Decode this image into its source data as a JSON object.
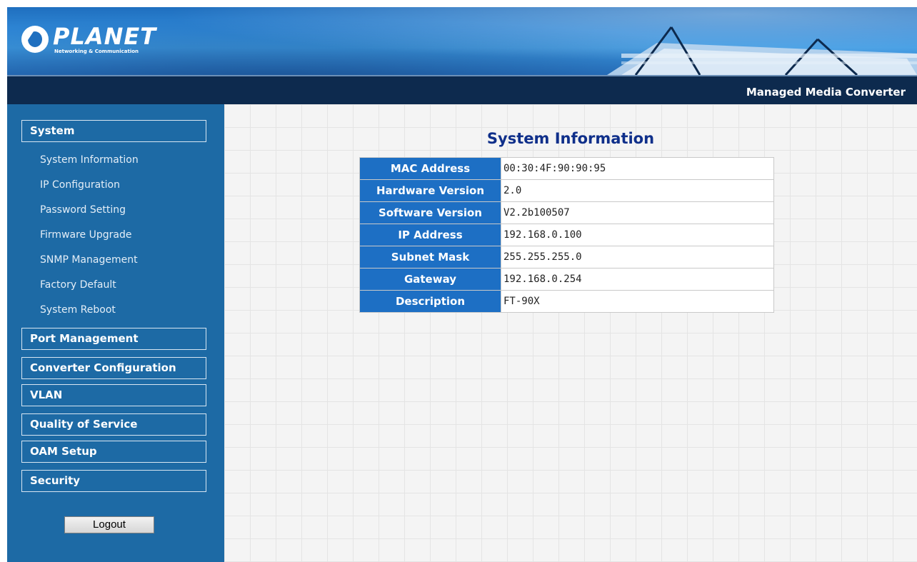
{
  "header": {
    "brand": "PLANET",
    "brand_tagline": "Networking & Communication",
    "product_name": "Managed Media Converter"
  },
  "sidebar": {
    "categories": [
      {
        "label": "System",
        "items": [
          "System Information",
          "IP Configuration",
          "Password Setting",
          "Firmware Upgrade",
          "SNMP Management",
          "Factory Default",
          "System Reboot"
        ]
      },
      {
        "label": "Port Management"
      },
      {
        "label": "Converter Configuration"
      },
      {
        "label": "VLAN"
      },
      {
        "label": "Quality of Service"
      },
      {
        "label": "OAM Setup"
      },
      {
        "label": "Security"
      }
    ],
    "logout_label": "Logout"
  },
  "main": {
    "title": "System Information",
    "rows": [
      {
        "key": "MAC Address",
        "value": "00:30:4F:90:90:95"
      },
      {
        "key": "Hardware Version",
        "value": "2.0"
      },
      {
        "key": "Software Version",
        "value": "V2.2b100507"
      },
      {
        "key": "IP Address",
        "value": "192.168.0.100"
      },
      {
        "key": "Subnet Mask",
        "value": "255.255.255.0"
      },
      {
        "key": "Gateway",
        "value": "192.168.0.254"
      },
      {
        "key": "Description",
        "value": "FT-90X"
      }
    ]
  },
  "colors": {
    "sidebar_bg": "#1d6aa5",
    "title_bar_bg": "#0d2a4e",
    "table_key_bg": "#1d6fc4",
    "page_title": "#0f2f8a"
  }
}
